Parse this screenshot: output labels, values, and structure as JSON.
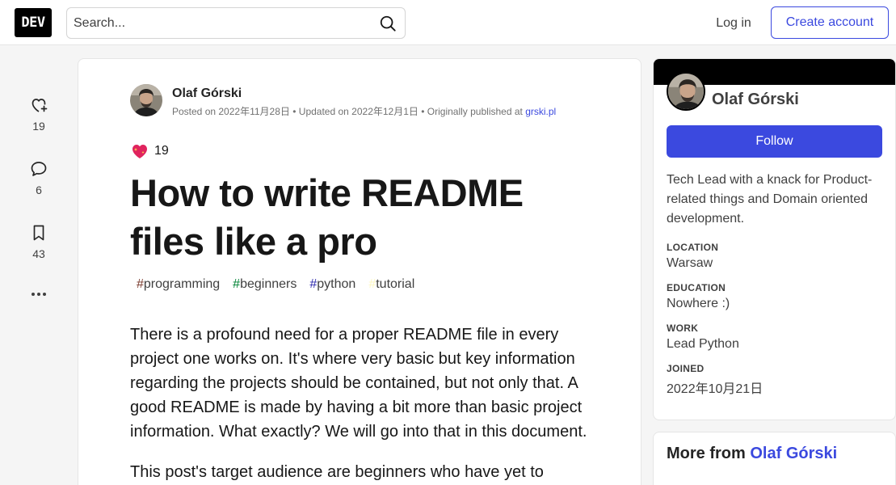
{
  "header": {
    "logo": "DEV",
    "search_placeholder": "Search...",
    "login": "Log in",
    "create_account": "Create account"
  },
  "rail": {
    "likes": "19",
    "comments": "6",
    "bookmarks": "43"
  },
  "article": {
    "author": "Olaf Górski",
    "posted": "Posted on 2022年11月28日",
    "updated": "Updated on 2022年12月1日",
    "originally": "Originally published at",
    "origin_link": "grski.pl",
    "reaction_count": "19",
    "title": "How to write README files like a pro",
    "tags": [
      {
        "hash": "#",
        "name": "programming",
        "color": "#7a3b2e"
      },
      {
        "hash": "#",
        "name": "beginners",
        "color": "#008335"
      },
      {
        "hash": "#",
        "name": "python",
        "color": "#2f2bad"
      },
      {
        "hash": "#",
        "name": "tutorial",
        "color": "#fef9c3"
      }
    ],
    "paragraphs": [
      "There is a profound need for a proper README file in every project one works on. It's where very basic but key information regarding the projects should be contained, but not only that. A good README is made by having a bit more than basic project information. What exactly? We will go into that in this document.",
      "This post's target audience are beginners who have yet to"
    ]
  },
  "sidebar": {
    "name": "Olaf Górski",
    "follow": "Follow",
    "bio": "Tech Lead with a knack for Product-related things and Domain oriented development.",
    "details": [
      {
        "label": "LOCATION",
        "value": "Warsaw"
      },
      {
        "label": "EDUCATION",
        "value": "Nowhere :)"
      },
      {
        "label": "WORK",
        "value": "Lead Python"
      },
      {
        "label": "JOINED",
        "value": "2022年10月21日"
      }
    ],
    "more_from_prefix": "More from",
    "more_from_name": "Olaf Górski"
  },
  "colors": {
    "accent": "#3b49df",
    "banner": "#000000"
  }
}
